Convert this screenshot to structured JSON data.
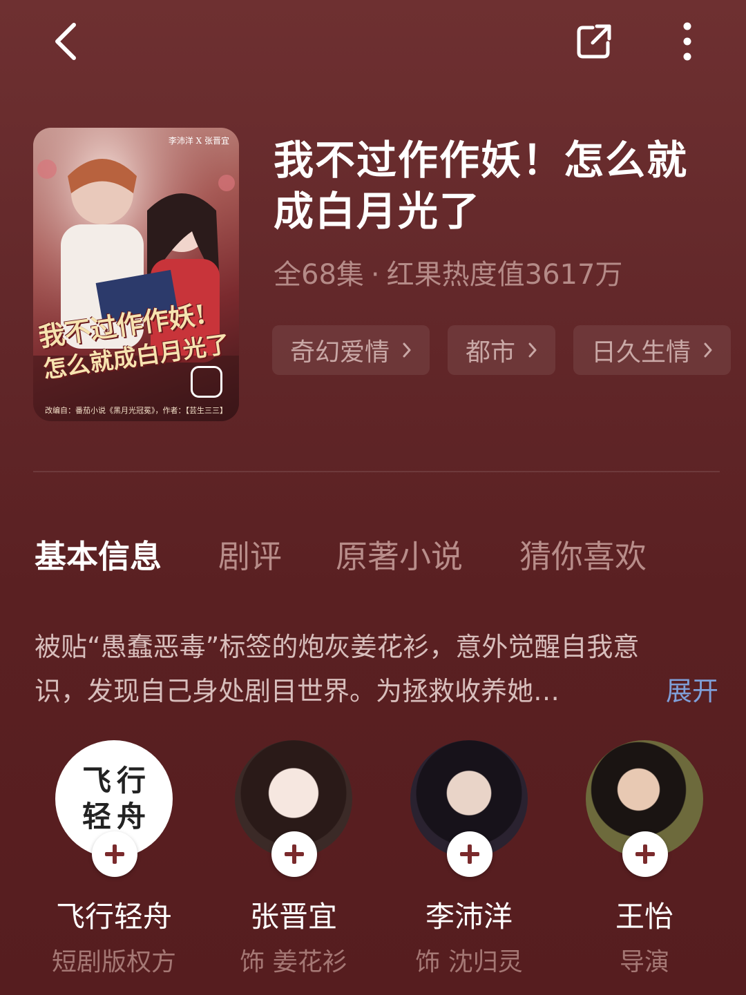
{
  "nav": {
    "back_icon": "chevron-left-icon",
    "share_icon": "share-external-icon",
    "more_icon": "more-vertical-icon"
  },
  "drama": {
    "title_line1": "我不过作作妖！怎么就",
    "title_line2": "成白月光了",
    "episodes": "全68集",
    "separator": "·",
    "heat": "红果热度值3617万",
    "tags": [
      "奇幻爱情",
      "都市",
      "日久生情"
    ],
    "poster": {
      "title_line1": "我不过作作妖!",
      "title_line2": "怎么就成白月光了",
      "cast_text": "李沛洋 X 张晋宜",
      "credit_text": "改编自：番茄小说《黑月光冠冕》，作者：【芸生三三】"
    }
  },
  "tabs": [
    "基本信息",
    "剧评",
    "原著小说",
    "猜你喜欢"
  ],
  "active_tab": 0,
  "description": {
    "line1": "被贴“愚蠢恶毒”标签的炮灰姜花衫，意外觉醒自我意",
    "line2": "识，发现自己身处剧目世界。为拯救收养她…",
    "expand_label": "展开"
  },
  "people": [
    {
      "avatar_text": "飞行\n轻舟",
      "name": "飞行轻舟",
      "role": "短剧版权方"
    },
    {
      "name": "张晋宜",
      "role": "饰 姜花衫"
    },
    {
      "name": "李沛洋",
      "role": "饰 沈归灵"
    },
    {
      "name": "王怡",
      "role": "导演"
    }
  ],
  "colors": {
    "background": "#63282a",
    "expand_link": "#7f9fd8",
    "meta_text": "#b58b88"
  }
}
